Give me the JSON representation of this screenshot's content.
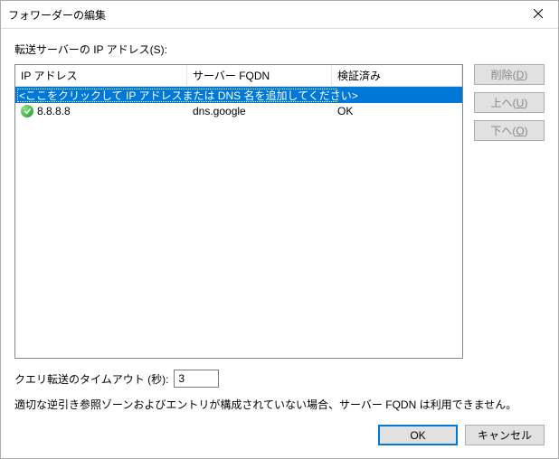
{
  "title": "フォワーダーの編集",
  "labels": {
    "ip_list": "転送サーバーの IP アドレス(S):",
    "timeout": "クエリ転送のタイムアウト (秒):",
    "note": "適切な逆引き参照ゾーンおよびエントリが構成されていない場合、サーバー FQDN は利用できません。"
  },
  "columns": {
    "ip": "IP アドレス",
    "fqdn": "サーバー FQDN",
    "validated": "検証済み"
  },
  "placeholder_text": "<ここをクリックして IP アドレスまたは DNS 名を追加してください>",
  "rows": [
    {
      "ip": "8.8.8.8",
      "fqdn": "dns.google",
      "validated": "OK"
    }
  ],
  "side_buttons": {
    "delete": "削除(D)",
    "up": "上へ(U)",
    "down": "下へ(O)"
  },
  "timeout_value": "3",
  "footer": {
    "ok": "OK",
    "cancel": "キャンセル"
  }
}
